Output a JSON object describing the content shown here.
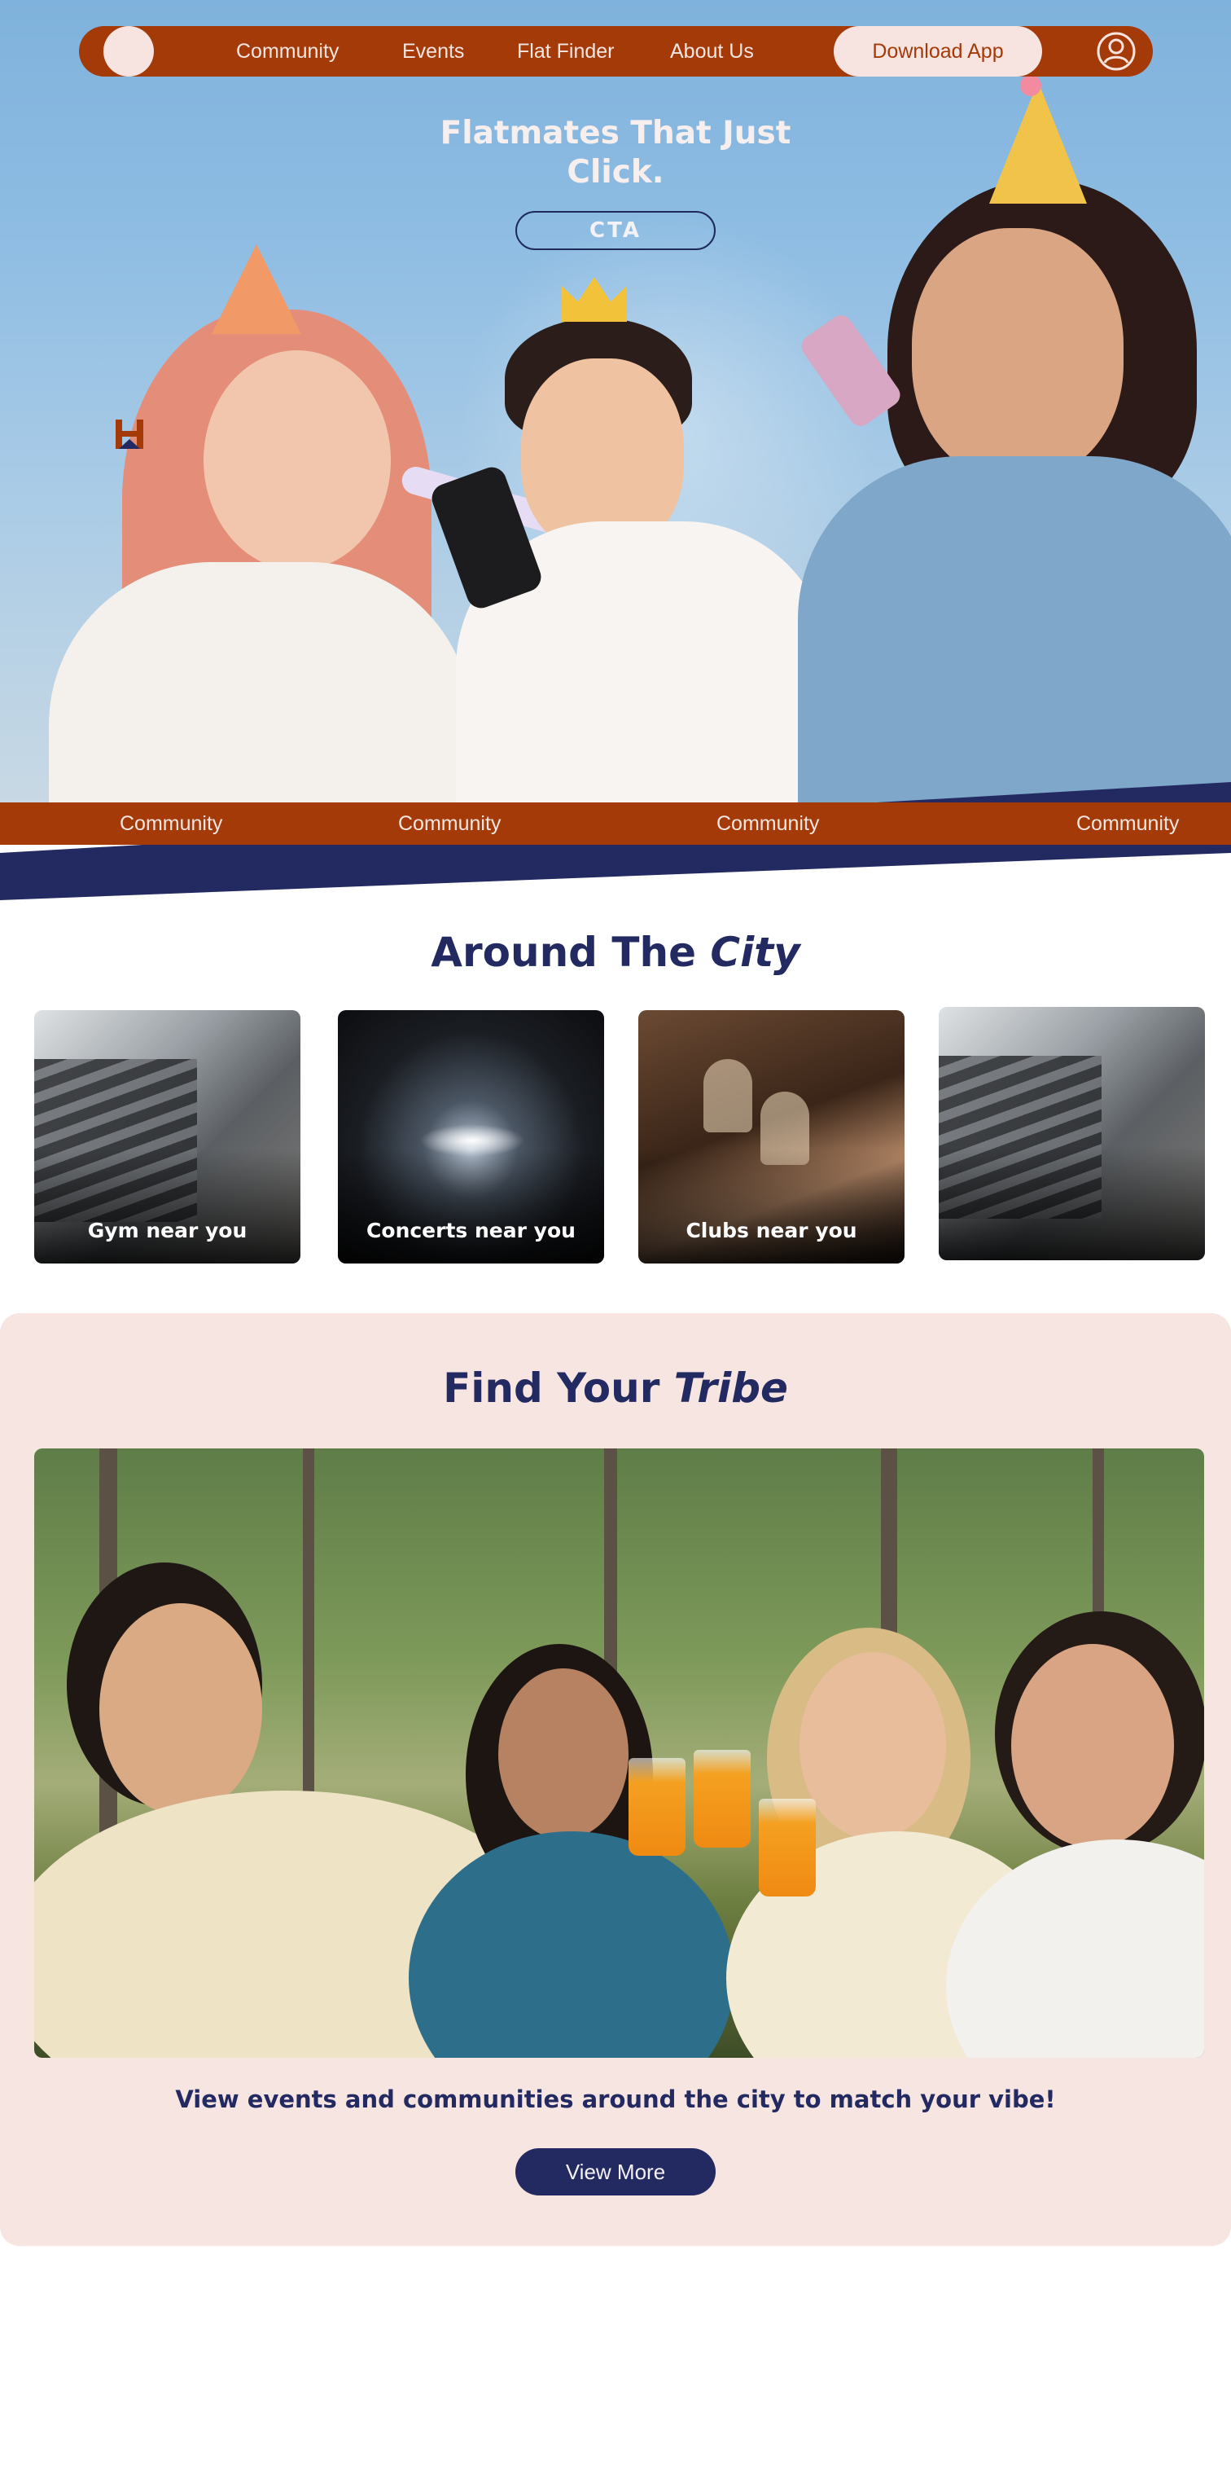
{
  "colors": {
    "brand_orange": "#a43a08",
    "brand_navy": "#232a61",
    "cream": "#f7e3df",
    "tribe_bg": "#f7e5e1"
  },
  "nav": {
    "links": [
      "Community",
      "Events",
      "Flat Finder",
      "About Us"
    ],
    "download_label": "Download App",
    "logo_icon": "logo-circle",
    "profile_icon": "user-circle-icon"
  },
  "hero": {
    "title": "Flatmates That Just Click.",
    "cta_label": "CTA"
  },
  "ribbon": {
    "items": [
      "Community",
      "Community",
      "Community",
      "Community"
    ]
  },
  "city": {
    "title_plain": "Around The ",
    "title_em": "City",
    "cards": [
      {
        "label": "Gym near you"
      },
      {
        "label": "Concerts near you"
      },
      {
        "label": "Clubs near you"
      },
      {
        "label": ""
      }
    ]
  },
  "tribe": {
    "title_plain": "Find Your ",
    "title_em": "Tribe",
    "subtitle": "View events and communities around the city to match your vibe!",
    "button_label": "View More"
  }
}
